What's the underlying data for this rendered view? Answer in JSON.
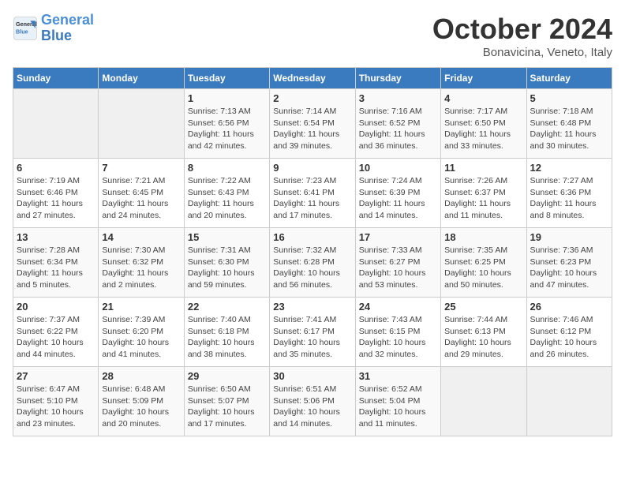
{
  "header": {
    "logo_general": "General",
    "logo_blue": "Blue",
    "month_title": "October 2024",
    "subtitle": "Bonavicina, Veneto, Italy"
  },
  "weekdays": [
    "Sunday",
    "Monday",
    "Tuesday",
    "Wednesday",
    "Thursday",
    "Friday",
    "Saturday"
  ],
  "weeks": [
    [
      null,
      null,
      {
        "day": 1,
        "sunrise": "7:13 AM",
        "sunset": "6:56 PM",
        "daylight": "11 hours and 42 minutes."
      },
      {
        "day": 2,
        "sunrise": "7:14 AM",
        "sunset": "6:54 PM",
        "daylight": "11 hours and 39 minutes."
      },
      {
        "day": 3,
        "sunrise": "7:16 AM",
        "sunset": "6:52 PM",
        "daylight": "11 hours and 36 minutes."
      },
      {
        "day": 4,
        "sunrise": "7:17 AM",
        "sunset": "6:50 PM",
        "daylight": "11 hours and 33 minutes."
      },
      {
        "day": 5,
        "sunrise": "7:18 AM",
        "sunset": "6:48 PM",
        "daylight": "11 hours and 30 minutes."
      }
    ],
    [
      {
        "day": 6,
        "sunrise": "7:19 AM",
        "sunset": "6:46 PM",
        "daylight": "11 hours and 27 minutes."
      },
      {
        "day": 7,
        "sunrise": "7:21 AM",
        "sunset": "6:45 PM",
        "daylight": "11 hours and 24 minutes."
      },
      {
        "day": 8,
        "sunrise": "7:22 AM",
        "sunset": "6:43 PM",
        "daylight": "11 hours and 20 minutes."
      },
      {
        "day": 9,
        "sunrise": "7:23 AM",
        "sunset": "6:41 PM",
        "daylight": "11 hours and 17 minutes."
      },
      {
        "day": 10,
        "sunrise": "7:24 AM",
        "sunset": "6:39 PM",
        "daylight": "11 hours and 14 minutes."
      },
      {
        "day": 11,
        "sunrise": "7:26 AM",
        "sunset": "6:37 PM",
        "daylight": "11 hours and 11 minutes."
      },
      {
        "day": 12,
        "sunrise": "7:27 AM",
        "sunset": "6:36 PM",
        "daylight": "11 hours and 8 minutes."
      }
    ],
    [
      {
        "day": 13,
        "sunrise": "7:28 AM",
        "sunset": "6:34 PM",
        "daylight": "11 hours and 5 minutes."
      },
      {
        "day": 14,
        "sunrise": "7:30 AM",
        "sunset": "6:32 PM",
        "daylight": "11 hours and 2 minutes."
      },
      {
        "day": 15,
        "sunrise": "7:31 AM",
        "sunset": "6:30 PM",
        "daylight": "10 hours and 59 minutes."
      },
      {
        "day": 16,
        "sunrise": "7:32 AM",
        "sunset": "6:28 PM",
        "daylight": "10 hours and 56 minutes."
      },
      {
        "day": 17,
        "sunrise": "7:33 AM",
        "sunset": "6:27 PM",
        "daylight": "10 hours and 53 minutes."
      },
      {
        "day": 18,
        "sunrise": "7:35 AM",
        "sunset": "6:25 PM",
        "daylight": "10 hours and 50 minutes."
      },
      {
        "day": 19,
        "sunrise": "7:36 AM",
        "sunset": "6:23 PM",
        "daylight": "10 hours and 47 minutes."
      }
    ],
    [
      {
        "day": 20,
        "sunrise": "7:37 AM",
        "sunset": "6:22 PM",
        "daylight": "10 hours and 44 minutes."
      },
      {
        "day": 21,
        "sunrise": "7:39 AM",
        "sunset": "6:20 PM",
        "daylight": "10 hours and 41 minutes."
      },
      {
        "day": 22,
        "sunrise": "7:40 AM",
        "sunset": "6:18 PM",
        "daylight": "10 hours and 38 minutes."
      },
      {
        "day": 23,
        "sunrise": "7:41 AM",
        "sunset": "6:17 PM",
        "daylight": "10 hours and 35 minutes."
      },
      {
        "day": 24,
        "sunrise": "7:43 AM",
        "sunset": "6:15 PM",
        "daylight": "10 hours and 32 minutes."
      },
      {
        "day": 25,
        "sunrise": "7:44 AM",
        "sunset": "6:13 PM",
        "daylight": "10 hours and 29 minutes."
      },
      {
        "day": 26,
        "sunrise": "7:46 AM",
        "sunset": "6:12 PM",
        "daylight": "10 hours and 26 minutes."
      }
    ],
    [
      {
        "day": 27,
        "sunrise": "6:47 AM",
        "sunset": "5:10 PM",
        "daylight": "10 hours and 23 minutes."
      },
      {
        "day": 28,
        "sunrise": "6:48 AM",
        "sunset": "5:09 PM",
        "daylight": "10 hours and 20 minutes."
      },
      {
        "day": 29,
        "sunrise": "6:50 AM",
        "sunset": "5:07 PM",
        "daylight": "10 hours and 17 minutes."
      },
      {
        "day": 30,
        "sunrise": "6:51 AM",
        "sunset": "5:06 PM",
        "daylight": "10 hours and 14 minutes."
      },
      {
        "day": 31,
        "sunrise": "6:52 AM",
        "sunset": "5:04 PM",
        "daylight": "10 hours and 11 minutes."
      },
      null,
      null
    ]
  ]
}
